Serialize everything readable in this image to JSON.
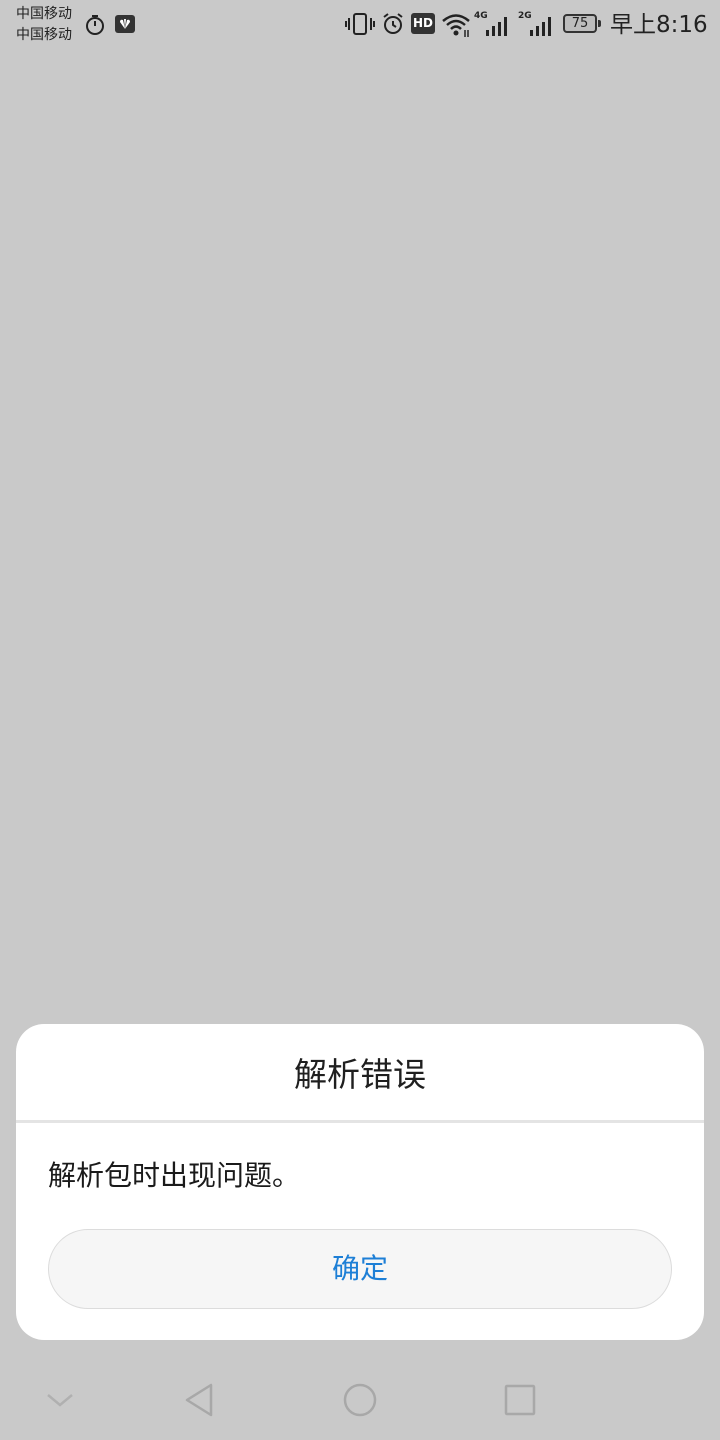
{
  "status_bar": {
    "carrier_1": "中国移动",
    "carrier_2": "中国移动",
    "hd_label": "HD",
    "sim1_network": "4G",
    "sim2_network": "2G",
    "battery_level": "75",
    "time": "早上8:16",
    "icons": [
      "timer-icon",
      "huawei-icon",
      "vibrate-icon",
      "alarm-icon",
      "wifi-icon",
      "signal-icon",
      "battery-icon"
    ]
  },
  "dialog": {
    "title": "解析错误",
    "message": "解析包时出现问题。",
    "confirm_label": "确定"
  },
  "navigation": {
    "icons": [
      "chevron-down-icon",
      "back-icon",
      "home-icon",
      "recent-apps-icon"
    ]
  },
  "colors": {
    "background": "#c9c9c9",
    "dialog_background": "#ffffff",
    "button_text": "#1d7fd6",
    "button_background": "#f6f6f6"
  }
}
